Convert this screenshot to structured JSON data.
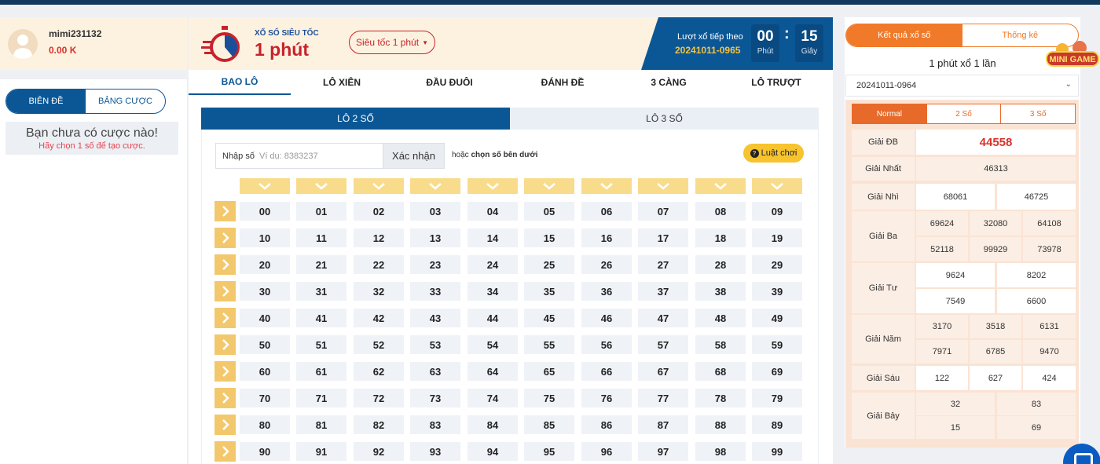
{
  "user": {
    "name": "mimi231132",
    "balance": "0.00 K"
  },
  "left_tabs": [
    {
      "label": "BIÊN ĐỀ",
      "active": true
    },
    {
      "label": "BẢNG CƯỢC",
      "active": false
    }
  ],
  "no_bet": {
    "title": "Bạn chưa có cược nào!",
    "subtitle": "Hãy chọn 1 số để tạo cược."
  },
  "header": {
    "logo_small": "XỔ SỐ SIÊU TỐC",
    "logo_big": "1 phút",
    "mode_select": "Siêu tốc 1 phút",
    "next_label": "Lượt xổ tiếp theo",
    "next_id": "20241011-0965",
    "countdown": [
      {
        "value": "00",
        "unit": "Phút"
      },
      {
        "value": "15",
        "unit": "Giây"
      }
    ]
  },
  "bet_tabs": [
    "BAO LÔ",
    "LÔ XIÊN",
    "ĐẦU ĐUÔI",
    "ĐÁNH ĐỀ",
    "3 CÀNG",
    "LÔ TRƯỢT"
  ],
  "sub_tabs": [
    "LÔ 2 SỐ",
    "LÔ 3 SỐ"
  ],
  "input": {
    "label": "Nhập số",
    "placeholder": "Ví dụ: 8383237",
    "confirm": "Xác nhận"
  },
  "or_text": {
    "prefix": "hoặc",
    "emphasis": "chọn số bên dưới"
  },
  "rules_label": "Luật chơi",
  "numbers": [
    [
      "00",
      "01",
      "02",
      "03",
      "04",
      "05",
      "06",
      "07",
      "08",
      "09"
    ],
    [
      "10",
      "11",
      "12",
      "13",
      "14",
      "15",
      "16",
      "17",
      "18",
      "19"
    ],
    [
      "20",
      "21",
      "22",
      "23",
      "24",
      "25",
      "26",
      "27",
      "28",
      "29"
    ],
    [
      "30",
      "31",
      "32",
      "33",
      "34",
      "35",
      "36",
      "37",
      "38",
      "39"
    ],
    [
      "40",
      "41",
      "42",
      "43",
      "44",
      "45",
      "46",
      "47",
      "48",
      "49"
    ],
    [
      "50",
      "51",
      "52",
      "53",
      "54",
      "55",
      "56",
      "57",
      "58",
      "59"
    ],
    [
      "60",
      "61",
      "62",
      "63",
      "64",
      "65",
      "66",
      "67",
      "68",
      "69"
    ],
    [
      "70",
      "71",
      "72",
      "73",
      "74",
      "75",
      "76",
      "77",
      "78",
      "79"
    ],
    [
      "80",
      "81",
      "82",
      "83",
      "84",
      "85",
      "86",
      "87",
      "88",
      "89"
    ],
    [
      "90",
      "91",
      "92",
      "93",
      "94",
      "95",
      "96",
      "97",
      "98",
      "99"
    ]
  ],
  "results": {
    "tabs": [
      {
        "label": "Kết quả xổ số",
        "active": true
      },
      {
        "label": "Thống kê",
        "active": false
      }
    ],
    "title": "1 phút xổ 1 lần",
    "period": "20241011-0964",
    "mode_tabs": [
      {
        "label": "Normal",
        "active": true
      },
      {
        "label": "2 Số",
        "active": false
      },
      {
        "label": "3 Số",
        "active": false
      }
    ],
    "prizes": [
      {
        "name": "Giải ĐB",
        "values": [
          "44558"
        ]
      },
      {
        "name": "Giải Nhất",
        "values": [
          "46313"
        ]
      },
      {
        "name": "Giải Nhì",
        "values": [
          "68061",
          "46725"
        ]
      },
      {
        "name": "Giải Ba",
        "values": [
          "69624",
          "32080",
          "64108",
          "52118",
          "99929",
          "73978"
        ]
      },
      {
        "name": "Giải Tư",
        "values": [
          "9624",
          "8202",
          "7549",
          "6600"
        ]
      },
      {
        "name": "Giải Năm",
        "values": [
          "3170",
          "3518",
          "6131",
          "7971",
          "6785",
          "9470"
        ]
      },
      {
        "name": "Giải Sáu",
        "values": [
          "122",
          "627",
          "424"
        ]
      },
      {
        "name": "Giải Bảy",
        "values": [
          "32",
          "83",
          "15",
          "69"
        ]
      }
    ]
  },
  "badge_text": "MINI GAME",
  "colors": {
    "primary": "#0b5796",
    "accent": "#f07a2a",
    "red": "#d8322c",
    "yellow": "#f7c32e"
  }
}
